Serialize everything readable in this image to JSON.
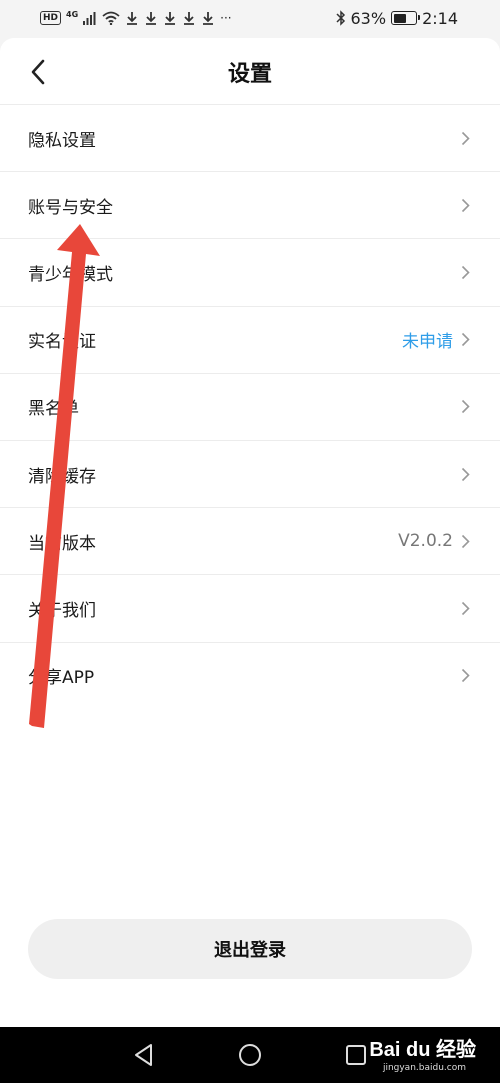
{
  "status": {
    "hd": "HD",
    "network": "4G",
    "dots": "···",
    "battery_pct": "63%",
    "battery_level": 0.63,
    "time": "2:14"
  },
  "header": {
    "title": "设置"
  },
  "settings": [
    {
      "label": "隐私设置",
      "value": ""
    },
    {
      "label": "账号与安全",
      "value": ""
    },
    {
      "label": "青少年模式",
      "value": ""
    },
    {
      "label": "实名认证",
      "value": "未申请"
    },
    {
      "label": "黑名单",
      "value": ""
    },
    {
      "label": "清除缓存",
      "value": ""
    },
    {
      "label": "当前版本",
      "value": "V2.0.2"
    },
    {
      "label": "关于我们",
      "value": ""
    },
    {
      "label": "分享APP",
      "value": ""
    }
  ],
  "logout_label": "退出登录",
  "watermark": {
    "brand": "Bai du 经验",
    "url": "jingyan.baidu.com"
  },
  "colors": {
    "accent_blue": "#2f9de8",
    "arrow_red": "#e8473a"
  }
}
